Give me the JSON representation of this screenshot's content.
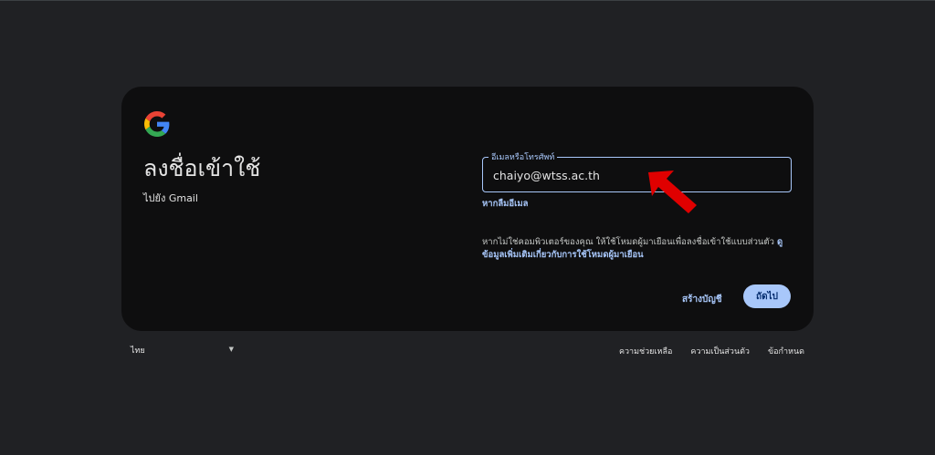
{
  "card": {
    "title": "ลงชื่อเข้าใช้",
    "subtitle": "ไปยัง Gmail"
  },
  "email_field": {
    "label": "อีเมลหรือโทรศัพท์",
    "value": "chaiyo@wtss.ac.th"
  },
  "forgot_email": "หากลืมอีเมล",
  "guest_notice": {
    "text": "หากไม่ใช่คอมพิวเตอร์ของคุณ ให้ใช้โหมดผู้มาเยือนเพื่อลงชื่อเข้าใช้แบบส่วนตัว ",
    "link": "ดูข้อมูลเพิ่มเติมเกี่ยวกับการใช้โหมดผู้มาเยือน"
  },
  "buttons": {
    "create_account": "สร้างบัญชี",
    "next": "ถัดไป"
  },
  "footer": {
    "language": "ไทย",
    "help": "ความช่วยเหลือ",
    "privacy": "ความเป็นส่วนตัว",
    "terms": "ข้อกำหนด"
  },
  "colors": {
    "page_bg": "#202124",
    "card_bg": "#0e0e0f",
    "accent": "#a8c7fa",
    "arrow": "#e00000"
  },
  "icons": {
    "logo": "google-g-logo",
    "annotation": "red-arrow-icon",
    "dropdown": "caret-down-icon"
  }
}
